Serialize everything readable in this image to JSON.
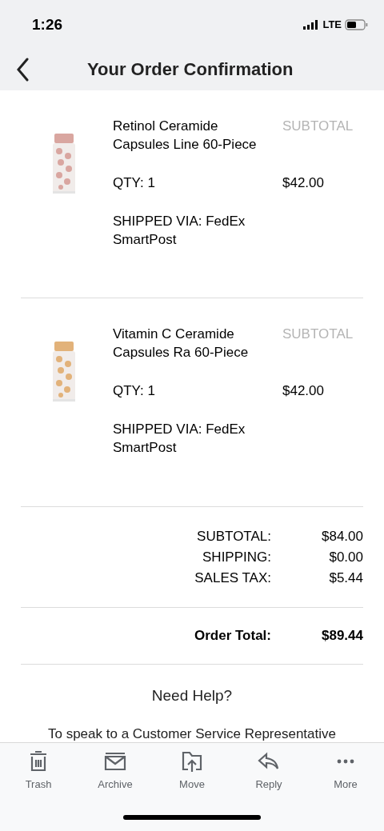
{
  "status_bar": {
    "time": "1:26",
    "network": "LTE"
  },
  "header": {
    "title": "Your Order Confirmation"
  },
  "items": [
    {
      "name": "Retinol Ceramide Capsules Line 60-Piece",
      "subtotal_label": "SUBTOTAL",
      "qty": "QTY: 1",
      "price": "$42.00",
      "shipping": "SHIPPED VIA: FedEx SmartPost"
    },
    {
      "name": "Vitamin C Ceramide Capsules Ra 60-Piece",
      "subtotal_label": "SUBTOTAL",
      "qty": "QTY: 1",
      "price": "$42.00",
      "shipping": "SHIPPED VIA: FedEx SmartPost"
    }
  ],
  "totals": [
    {
      "label": "SUBTOTAL:",
      "value": "$84.00"
    },
    {
      "label": "SHIPPING:",
      "value": "$0.00"
    },
    {
      "label": "SALES TAX:",
      "value": "$5.44"
    }
  ],
  "order_total": {
    "label": "Order Total:",
    "value": "$89.44"
  },
  "help": {
    "title": "Need Help?",
    "text": "To speak to a Customer Service Representative"
  },
  "toolbar": [
    {
      "kind": "trash",
      "label": "Trash"
    },
    {
      "kind": "archive",
      "label": "Archive"
    },
    {
      "kind": "move",
      "label": "Move"
    },
    {
      "kind": "reply",
      "label": "Reply"
    },
    {
      "kind": "more",
      "label": "More"
    }
  ]
}
